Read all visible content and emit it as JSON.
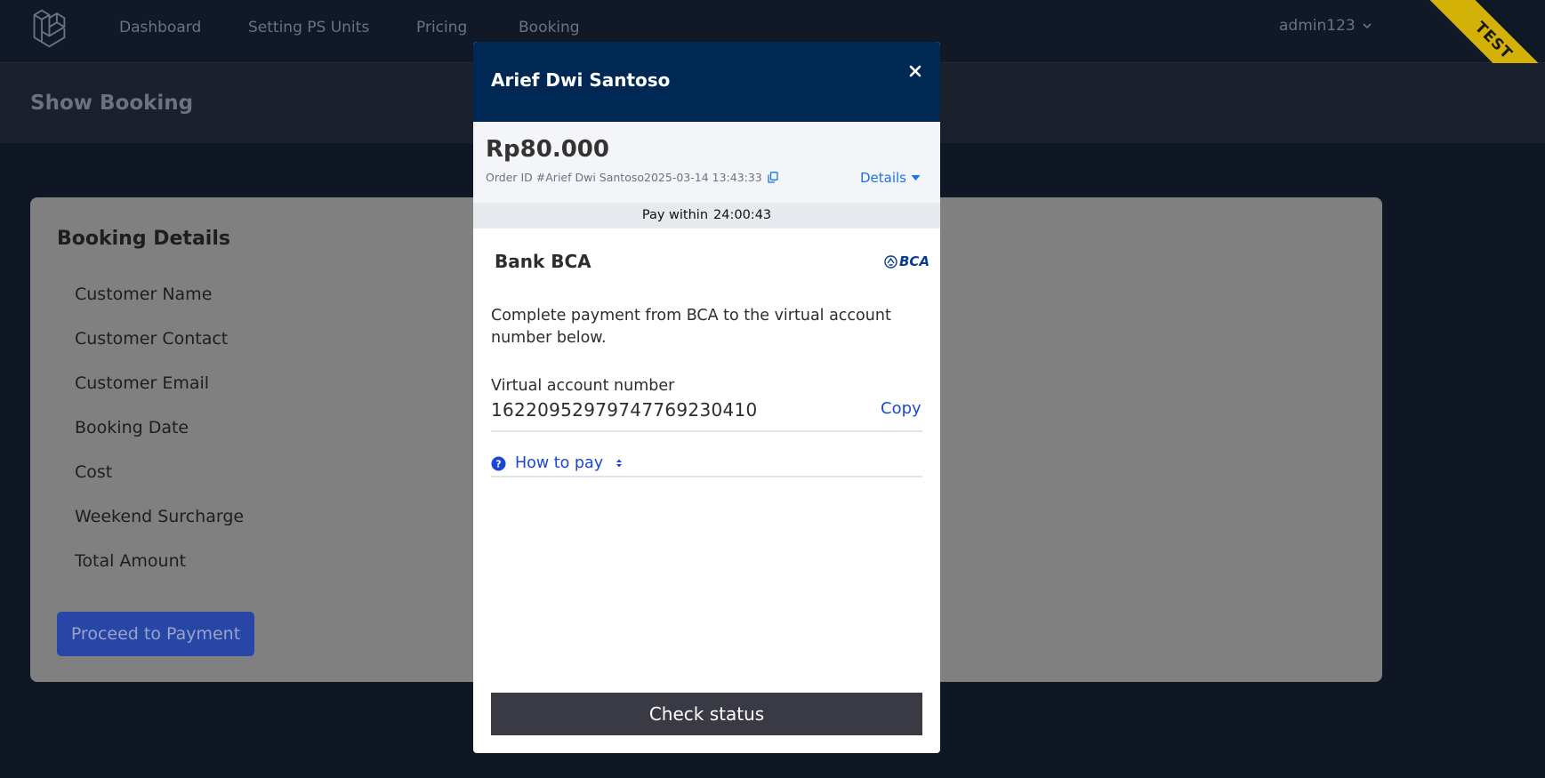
{
  "nav": {
    "items": [
      "Dashboard",
      "Setting PS Units",
      "Pricing",
      "Booking"
    ],
    "user": "admin123",
    "ribbon": "TEST"
  },
  "page": {
    "title": "Show Booking"
  },
  "booking": {
    "title": "Booking Details",
    "fields": [
      "Customer Name",
      "Customer Contact",
      "Customer Email",
      "Booking Date",
      "Cost",
      "Weekend Surcharge",
      "Total Amount"
    ],
    "proceed_label": "Proceed to Payment"
  },
  "modal": {
    "customer_name": "Arief Dwi Santoso",
    "amount": "Rp80.000",
    "order_id": "Order ID #Arief Dwi Santoso2025-03-14 13:43:33",
    "details_label": "Details",
    "pay_within_label": "Pay within",
    "pay_within_time": "24:00:43",
    "bank_name": "Bank BCA",
    "bank_logo_text": "BCA",
    "instruction": "Complete payment from BCA to the virtual account number below.",
    "va_label": "Virtual account number",
    "va_number": "16220952979747769230410",
    "copy_label": "Copy",
    "how_to_pay": "How to pay",
    "check_status": "Check status"
  },
  "colors": {
    "modal_header": "#002855",
    "link": "#1a47d6",
    "check_button": "#393a44",
    "ribbon": "#d4b106",
    "proceed_button": "#2746a6"
  }
}
